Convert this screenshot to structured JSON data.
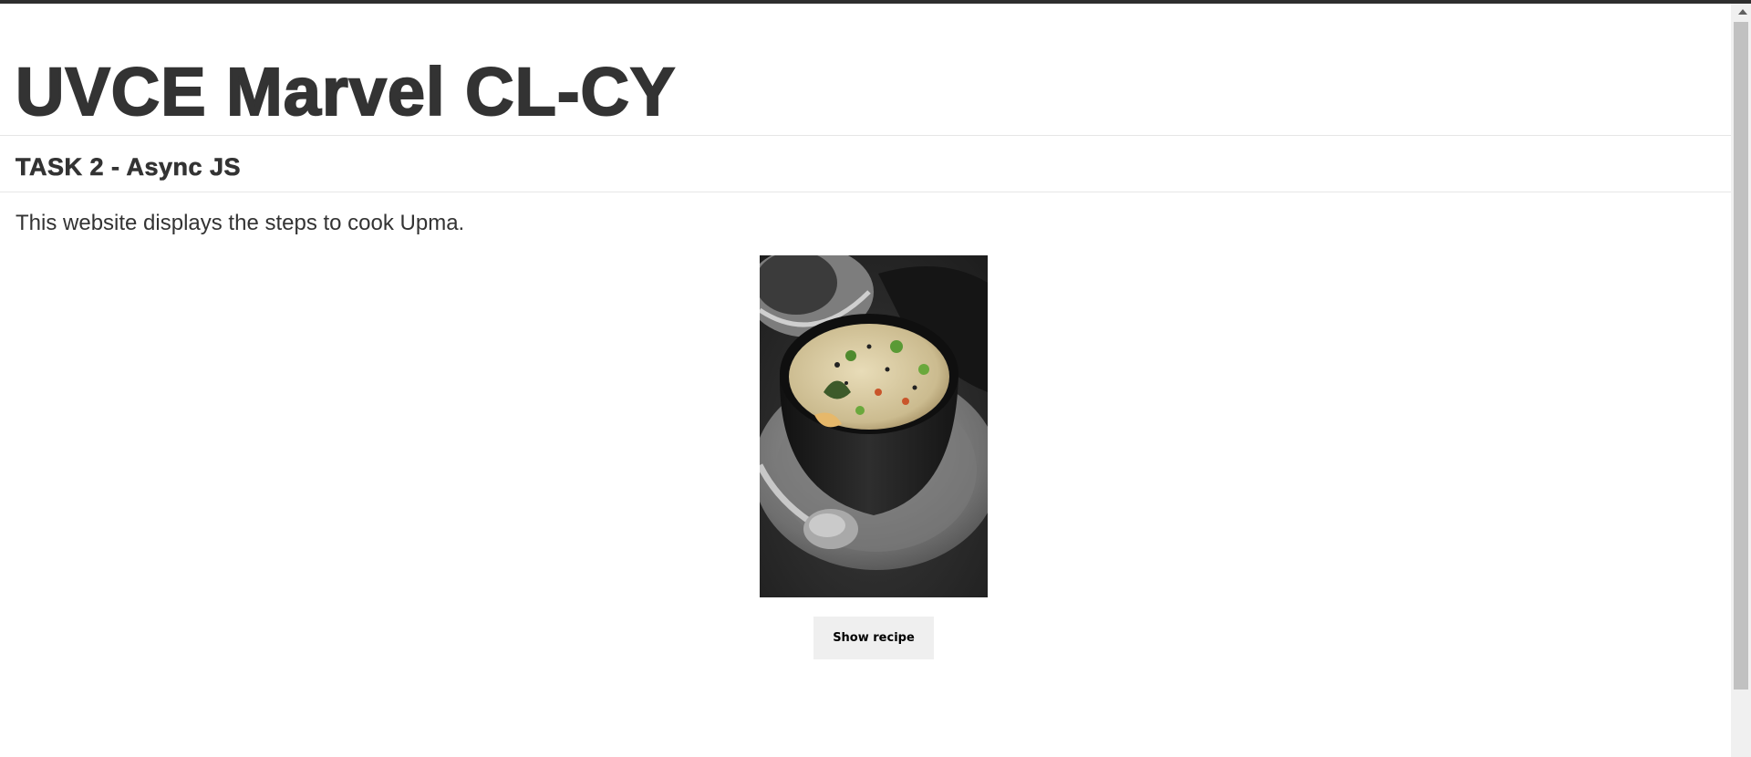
{
  "page": {
    "title": "UVCE Marvel CL-CY",
    "subtitle": "TASK 2 - Async JS",
    "intro": "This website displays the steps to cook Upma."
  },
  "image": {
    "alt": "Bowl of upma with cashew and curry leaves on a grey saucer with a spoon",
    "icon": "food-photo"
  },
  "actions": {
    "show_recipe_label": "Show recipe"
  },
  "colors": {
    "text": "#333333",
    "top_bar": "#2e2e2e",
    "button_bg": "#efefef",
    "rule": "#e6e6e6"
  }
}
